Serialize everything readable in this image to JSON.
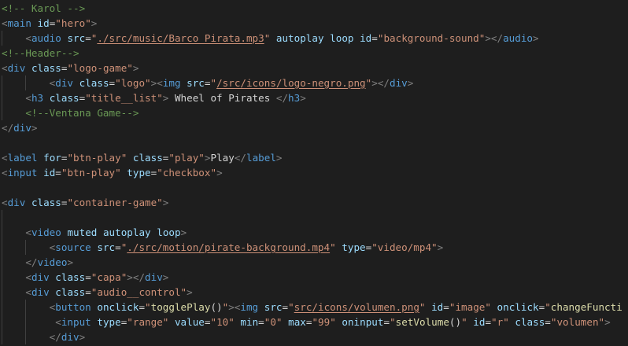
{
  "editor": {
    "theme_colors": {
      "background": "#1e1e1e",
      "comment": "#6a9955",
      "punctuation": "#808080",
      "tag": "#569cd6",
      "attribute": "#9cdcfe",
      "string": "#ce9178",
      "text": "#d4d4d4",
      "function": "#dcdcaa"
    },
    "lines": [
      [
        [
          "comment",
          "<!-- Karol -->"
        ]
      ],
      [
        [
          "punct",
          "<"
        ],
        [
          "tag",
          "main"
        ],
        [
          "text",
          " "
        ],
        [
          "attr",
          "id"
        ],
        [
          "eq",
          "="
        ],
        [
          "str",
          "\"hero\""
        ],
        [
          "punct",
          ">"
        ]
      ],
      [
        [
          "text",
          "    "
        ],
        [
          "punct",
          "<"
        ],
        [
          "tag",
          "audio"
        ],
        [
          "text",
          " "
        ],
        [
          "attr",
          "src"
        ],
        [
          "eq",
          "="
        ],
        [
          "str",
          "\""
        ],
        [
          "strlink",
          "./src/music/Barco Pirata.mp3"
        ],
        [
          "str",
          "\""
        ],
        [
          "text",
          " "
        ],
        [
          "attr",
          "autoplay"
        ],
        [
          "text",
          " "
        ],
        [
          "attr",
          "loop"
        ],
        [
          "text",
          " "
        ],
        [
          "attr",
          "id"
        ],
        [
          "eq",
          "="
        ],
        [
          "str",
          "\"background-sound\""
        ],
        [
          "punct",
          "></"
        ],
        [
          "tag",
          "audio"
        ],
        [
          "punct",
          ">"
        ]
      ],
      [
        [
          "comment",
          "<!--Header-->"
        ]
      ],
      [
        [
          "punct",
          "<"
        ],
        [
          "tag",
          "div"
        ],
        [
          "text",
          " "
        ],
        [
          "attr",
          "class"
        ],
        [
          "eq",
          "="
        ],
        [
          "str",
          "\"logo-game\""
        ],
        [
          "punct",
          ">"
        ]
      ],
      [
        [
          "text",
          "        "
        ],
        [
          "punct",
          "<"
        ],
        [
          "tag",
          "div"
        ],
        [
          "text",
          " "
        ],
        [
          "attr",
          "class"
        ],
        [
          "eq",
          "="
        ],
        [
          "str",
          "\"logo\""
        ],
        [
          "punct",
          "><"
        ],
        [
          "tag",
          "img"
        ],
        [
          "text",
          " "
        ],
        [
          "attr",
          "src"
        ],
        [
          "eq",
          "="
        ],
        [
          "str",
          "\""
        ],
        [
          "strlink",
          "/src/icons/logo-negro.png"
        ],
        [
          "str",
          "\""
        ],
        [
          "punct",
          "></"
        ],
        [
          "tag",
          "div"
        ],
        [
          "punct",
          ">"
        ]
      ],
      [
        [
          "text",
          "    "
        ],
        [
          "punct",
          "<"
        ],
        [
          "tag",
          "h3"
        ],
        [
          "text",
          " "
        ],
        [
          "attr",
          "class"
        ],
        [
          "eq",
          "="
        ],
        [
          "str",
          "\"title__list\""
        ],
        [
          "punct",
          ">"
        ],
        [
          "text",
          " Wheel of Pirates "
        ],
        [
          "punct",
          "</"
        ],
        [
          "tag",
          "h3"
        ],
        [
          "punct",
          ">"
        ]
      ],
      [
        [
          "text",
          "    "
        ],
        [
          "comment",
          "<!--Ventana Game-->"
        ]
      ],
      [
        [
          "punct",
          "</"
        ],
        [
          "tag",
          "div"
        ],
        [
          "punct",
          ">"
        ]
      ],
      [],
      [
        [
          "punct",
          "<"
        ],
        [
          "tag",
          "label"
        ],
        [
          "text",
          " "
        ],
        [
          "attr",
          "for"
        ],
        [
          "eq",
          "="
        ],
        [
          "str",
          "\"btn-play\""
        ],
        [
          "text",
          " "
        ],
        [
          "attr",
          "class"
        ],
        [
          "eq",
          "="
        ],
        [
          "str",
          "\"play\""
        ],
        [
          "punct",
          ">"
        ],
        [
          "text",
          "Play"
        ],
        [
          "punct",
          "</"
        ],
        [
          "tag",
          "label"
        ],
        [
          "punct",
          ">"
        ]
      ],
      [
        [
          "punct",
          "<"
        ],
        [
          "tag",
          "input"
        ],
        [
          "text",
          " "
        ],
        [
          "attr",
          "id"
        ],
        [
          "eq",
          "="
        ],
        [
          "str",
          "\"btn-play\""
        ],
        [
          "text",
          " "
        ],
        [
          "attr",
          "type"
        ],
        [
          "eq",
          "="
        ],
        [
          "str",
          "\"checkbox\""
        ],
        [
          "punct",
          ">"
        ]
      ],
      [],
      [
        [
          "punct",
          "<"
        ],
        [
          "tag",
          "div"
        ],
        [
          "text",
          " "
        ],
        [
          "attr",
          "class"
        ],
        [
          "eq",
          "="
        ],
        [
          "str",
          "\"container-game\""
        ],
        [
          "punct",
          ">"
        ]
      ],
      [],
      [
        [
          "text",
          "    "
        ],
        [
          "punct",
          "<"
        ],
        [
          "tag",
          "video"
        ],
        [
          "text",
          " "
        ],
        [
          "attr",
          "muted"
        ],
        [
          "text",
          " "
        ],
        [
          "attr",
          "autoplay"
        ],
        [
          "text",
          " "
        ],
        [
          "attr",
          "loop"
        ],
        [
          "punct",
          ">"
        ]
      ],
      [
        [
          "text",
          "        "
        ],
        [
          "punct",
          "<"
        ],
        [
          "tag",
          "source"
        ],
        [
          "text",
          " "
        ],
        [
          "attr",
          "src"
        ],
        [
          "eq",
          "="
        ],
        [
          "str",
          "\""
        ],
        [
          "strlink",
          "./src/motion/pirate-background.mp4"
        ],
        [
          "str",
          "\""
        ],
        [
          "text",
          " "
        ],
        [
          "attr",
          "type"
        ],
        [
          "eq",
          "="
        ],
        [
          "str",
          "\"video/mp4\""
        ],
        [
          "punct",
          ">"
        ]
      ],
      [
        [
          "text",
          "    "
        ],
        [
          "punct",
          "</"
        ],
        [
          "tag",
          "video"
        ],
        [
          "punct",
          ">"
        ]
      ],
      [
        [
          "text",
          "    "
        ],
        [
          "punct",
          "<"
        ],
        [
          "tag",
          "div"
        ],
        [
          "text",
          " "
        ],
        [
          "attr",
          "class"
        ],
        [
          "eq",
          "="
        ],
        [
          "str",
          "\"capa\""
        ],
        [
          "punct",
          "></"
        ],
        [
          "tag",
          "div"
        ],
        [
          "punct",
          ">"
        ]
      ],
      [
        [
          "text",
          "    "
        ],
        [
          "punct",
          "<"
        ],
        [
          "tag",
          "div"
        ],
        [
          "text",
          " "
        ],
        [
          "attr",
          "class"
        ],
        [
          "eq",
          "="
        ],
        [
          "str",
          "\"audio__control\""
        ],
        [
          "punct",
          ">"
        ]
      ],
      [
        [
          "text",
          "        "
        ],
        [
          "punct",
          "<"
        ],
        [
          "tag",
          "button"
        ],
        [
          "text",
          " "
        ],
        [
          "attr",
          "onclick"
        ],
        [
          "eq",
          "="
        ],
        [
          "str",
          "\""
        ],
        [
          "fn",
          "togglePlay"
        ],
        [
          "text",
          "()"
        ],
        [
          "str",
          "\""
        ],
        [
          "punct",
          "><"
        ],
        [
          "tag",
          "img"
        ],
        [
          "text",
          " "
        ],
        [
          "attr",
          "src"
        ],
        [
          "eq",
          "="
        ],
        [
          "str",
          "\""
        ],
        [
          "strlink",
          "src/icons/volumen.png"
        ],
        [
          "str",
          "\""
        ],
        [
          "text",
          " "
        ],
        [
          "attr",
          "id"
        ],
        [
          "eq",
          "="
        ],
        [
          "str",
          "\"image\""
        ],
        [
          "text",
          " "
        ],
        [
          "attr",
          "onclick"
        ],
        [
          "eq",
          "="
        ],
        [
          "str",
          "\""
        ],
        [
          "fn",
          "changeFuncti"
        ]
      ],
      [
        [
          "text",
          "         "
        ],
        [
          "punct",
          "<"
        ],
        [
          "tag",
          "input"
        ],
        [
          "text",
          " "
        ],
        [
          "attr",
          "type"
        ],
        [
          "eq",
          "="
        ],
        [
          "str",
          "\"range\""
        ],
        [
          "text",
          " "
        ],
        [
          "attr",
          "value"
        ],
        [
          "eq",
          "="
        ],
        [
          "str",
          "\"10\""
        ],
        [
          "text",
          " "
        ],
        [
          "attr",
          "min"
        ],
        [
          "eq",
          "="
        ],
        [
          "str",
          "\"0\""
        ],
        [
          "text",
          " "
        ],
        [
          "attr",
          "max"
        ],
        [
          "eq",
          "="
        ],
        [
          "str",
          "\"99\""
        ],
        [
          "text",
          " "
        ],
        [
          "attr",
          "oninput"
        ],
        [
          "eq",
          "="
        ],
        [
          "str",
          "\""
        ],
        [
          "fn",
          "setVolume"
        ],
        [
          "text",
          "()"
        ],
        [
          "str",
          "\""
        ],
        [
          "text",
          " "
        ],
        [
          "attr",
          "id"
        ],
        [
          "eq",
          "="
        ],
        [
          "str",
          "\"r\""
        ],
        [
          "text",
          " "
        ],
        [
          "attr",
          "class"
        ],
        [
          "eq",
          "="
        ],
        [
          "str",
          "\"volumen\""
        ],
        [
          "punct",
          ">"
        ]
      ],
      [
        [
          "text",
          "        "
        ],
        [
          "punct",
          "</"
        ],
        [
          "tag",
          "div"
        ],
        [
          "punct",
          ">"
        ]
      ]
    ]
  }
}
